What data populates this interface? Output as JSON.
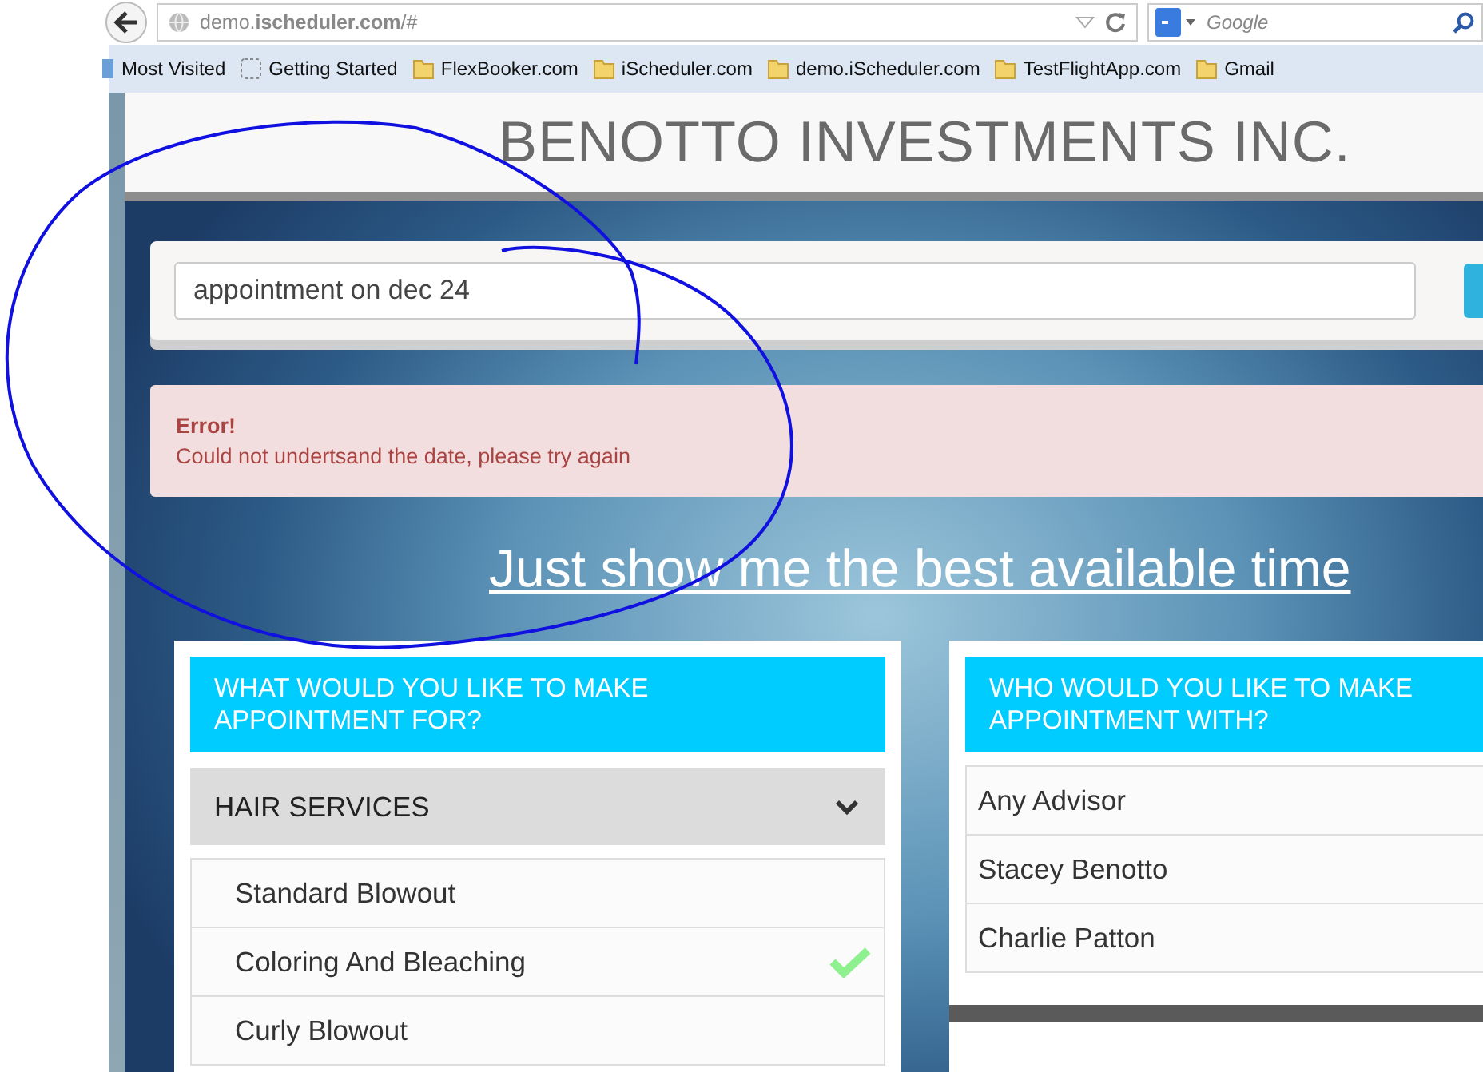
{
  "browser": {
    "url": "demo.**ischeduler.com**/#",
    "search_placeholder": "Google",
    "bookmarks": [
      {
        "label": "Most Visited",
        "kind": "smart"
      },
      {
        "label": "Getting Started",
        "kind": "page"
      },
      {
        "label": "FlexBooker.com",
        "kind": "folder"
      },
      {
        "label": "iScheduler.com",
        "kind": "folder"
      },
      {
        "label": "demo.iScheduler.com",
        "kind": "folder"
      },
      {
        "label": "TestFlightApp.com",
        "kind": "folder"
      },
      {
        "label": "Gmail",
        "kind": "folder"
      }
    ]
  },
  "header": {
    "title": "BENOTTO INVESTMENTS INC."
  },
  "search": {
    "value": "appointment on dec 24"
  },
  "alert": {
    "title": "Error!",
    "message": "Could not undertsand the date, please try again"
  },
  "best_time_link": "Just show me the best available time",
  "services_panel": {
    "heading": "WHAT WOULD YOU LIKE TO MAKE APPOINTMENT FOR?",
    "category": {
      "label": "HAIR SERVICES",
      "expanded": true
    },
    "items": [
      {
        "label": "Standard Blowout",
        "selected": false
      },
      {
        "label": "Coloring And Bleaching",
        "selected": true
      },
      {
        "label": "Curly Blowout",
        "selected": false
      }
    ]
  },
  "advisors_panel": {
    "heading": "WHO WOULD YOU LIKE TO MAKE APPOINTMENT WITH?",
    "items": [
      {
        "label": "Any Advisor"
      },
      {
        "label": "Stacey Benotto"
      },
      {
        "label": "Charlie Patton"
      }
    ]
  }
}
